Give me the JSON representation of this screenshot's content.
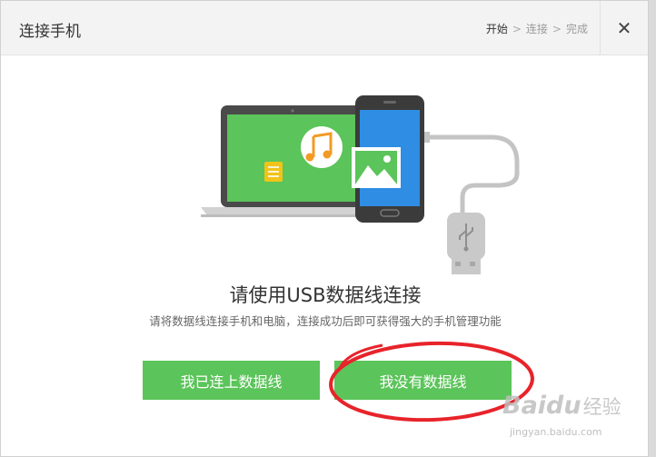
{
  "window": {
    "title": "连接手机",
    "close_label": "✕"
  },
  "steps": {
    "items": [
      "开始",
      "连接",
      "完成"
    ],
    "separator": ">",
    "active_index": 0
  },
  "main": {
    "heading": "请使用USB数据线连接",
    "subtext": "请将数据线连接手机和电脑，连接成功后即可获得强大的手机管理功能"
  },
  "buttons": {
    "connected": "我已连上数据线",
    "no_cable": "我没有数据线"
  },
  "watermark": {
    "brand": "Baidu",
    "suffix": "经验",
    "url": "jingyan.baidu.com"
  },
  "colors": {
    "accent_green": "#5bc45a",
    "screen_green": "#5bc45a",
    "phone_screen": "#2f8de4",
    "annotation_red": "#e8232a"
  },
  "icons": [
    "music-note-icon",
    "document-icon",
    "picture-icon",
    "usb-plug-icon",
    "close-icon"
  ]
}
